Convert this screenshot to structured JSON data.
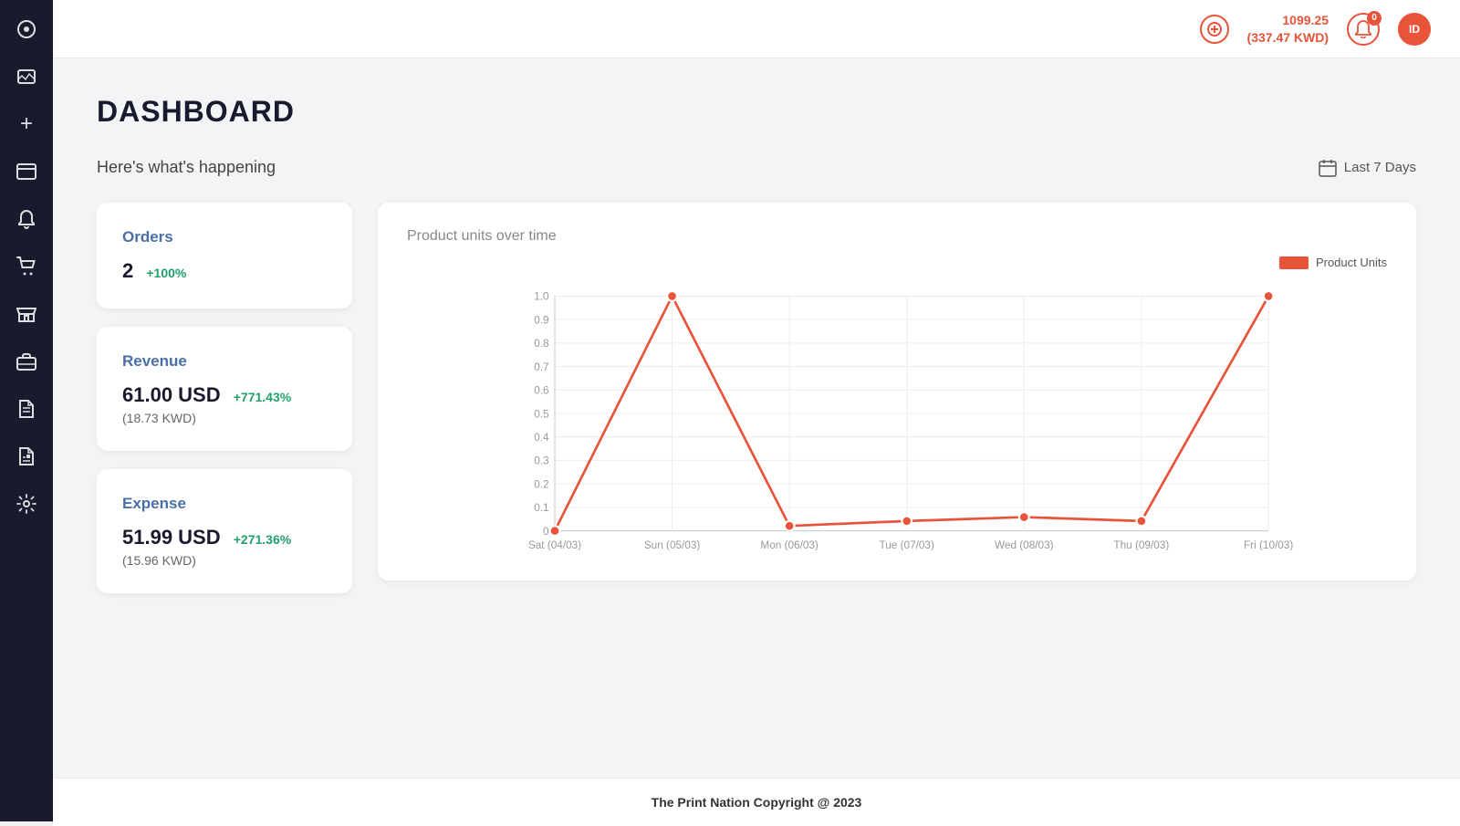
{
  "sidebar": {
    "icons": [
      {
        "name": "dashboard-icon",
        "symbol": "◉"
      },
      {
        "name": "image-icon",
        "symbol": "🖼"
      },
      {
        "name": "add-icon",
        "symbol": "+"
      },
      {
        "name": "menu-icon",
        "symbol": "▤"
      },
      {
        "name": "bell-icon",
        "symbol": "🔔"
      },
      {
        "name": "cart-icon",
        "symbol": "🛒"
      },
      {
        "name": "shop-icon",
        "symbol": "🛍"
      },
      {
        "name": "briefcase-icon",
        "symbol": "💼"
      },
      {
        "name": "file-icon",
        "symbol": "📄"
      },
      {
        "name": "report-icon",
        "symbol": "📋"
      },
      {
        "name": "settings-icon",
        "symbol": "⚙"
      }
    ]
  },
  "header": {
    "balance_primary": "1099.25",
    "balance_secondary": "(337.47 KWD)",
    "notification_count": "0",
    "user_label": "ID",
    "add_label": "+"
  },
  "page": {
    "title": "DASHBOARD",
    "subtitle": "Here's what's happening",
    "date_filter": "Last 7 Days"
  },
  "stats": {
    "orders": {
      "title": "Orders",
      "value": "2",
      "change": "+100%"
    },
    "revenue": {
      "title": "Revenue",
      "primary": "61.00 USD",
      "change": "+771.43%",
      "secondary": "(18.73 KWD)"
    },
    "expense": {
      "title": "Expense",
      "primary": "51.99 USD",
      "change": "+271.36%",
      "secondary": "(15.96 KWD)"
    }
  },
  "chart": {
    "title": "Product units over time",
    "legend_label": "Product Units",
    "x_labels": [
      "Sat (04/03)",
      "Sun (05/03)",
      "Mon (06/03)",
      "Tue (07/03)",
      "Wed (08/03)",
      "Thu (09/03)",
      "Fri (10/03)"
    ],
    "y_labels": [
      "0",
      "0.1",
      "0.2",
      "0.3",
      "0.4",
      "0.5",
      "0.6",
      "0.7",
      "0.8",
      "0.9",
      "1.0"
    ],
    "data_points": [
      0,
      1.0,
      0.02,
      0.04,
      0.06,
      0.04,
      1.0
    ]
  },
  "footer": {
    "text": "The Print Nation Copyright @ 2023"
  }
}
